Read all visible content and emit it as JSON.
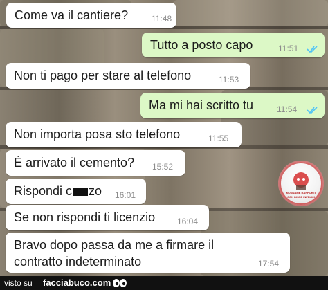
{
  "messages": [
    {
      "text": "Come va il cantiere?",
      "time": "11:48",
      "direction": "incoming"
    },
    {
      "text": "Tutto a posto capo",
      "time": "11:51",
      "direction": "outgoing",
      "read": true
    },
    {
      "text": "Non ti pago per stare al telefono",
      "time": "11:53",
      "direction": "incoming"
    },
    {
      "text": "Ma mi hai scritto tu",
      "time": "11:54",
      "direction": "outgoing",
      "read": true
    },
    {
      "text": "Non importa posa sto telefono",
      "time": "11:55",
      "direction": "incoming"
    },
    {
      "text": "È arrivato il cemento?",
      "time": "15:52",
      "direction": "incoming"
    },
    {
      "text_before": "Rispondi c",
      "text_after": "zo",
      "time": "16:01",
      "direction": "incoming"
    },
    {
      "text": "Se non rispondi ti licenzio",
      "time": "16:04",
      "direction": "incoming"
    },
    {
      "line1": "Bravo dopo passa da me a firmare il",
      "line2": "contratto indeterminato",
      "time": "17:54",
      "direction": "incoming"
    }
  ],
  "colors": {
    "incoming_bubble": "#ffffff",
    "outgoing_bubble": "#dcf8c6",
    "read_ticks": "#4fc3f7",
    "footer": "#111111"
  },
  "footer": {
    "prefix": "visto su",
    "site": "facciabuco.com"
  },
  "watermark": {
    "top_text": "NONNAME RAPPORTI",
    "bottom_text": "CON DISSE INFELICI"
  }
}
